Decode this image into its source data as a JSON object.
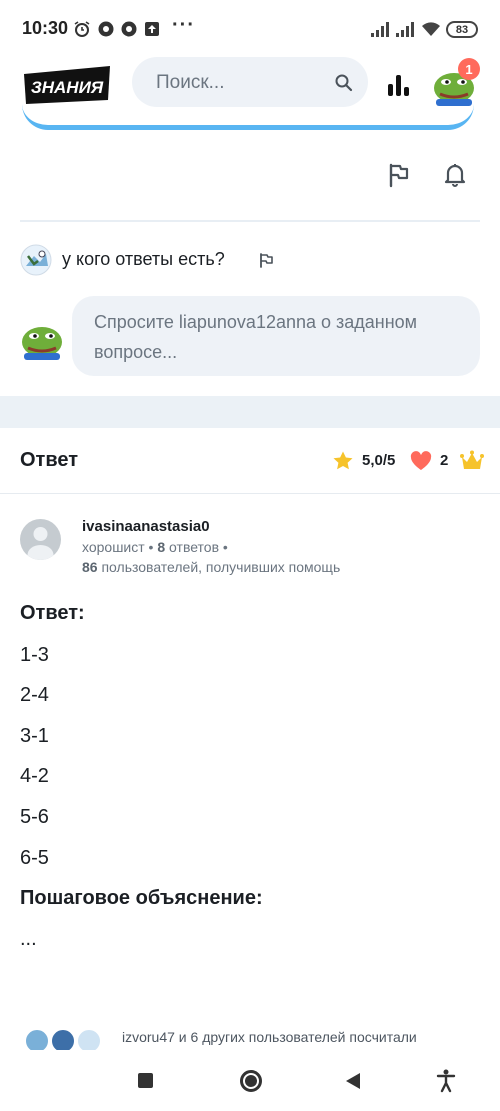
{
  "status_bar": {
    "time": "10:30",
    "dots": "···",
    "battery": "83",
    "icons": [
      "alarm-icon",
      "chrome-icon",
      "chrome-icon",
      "upload-icon",
      "signal-icon",
      "signal-icon",
      "wifi-icon",
      "battery-icon"
    ]
  },
  "header": {
    "logo_text": "ЗНАНИЯ",
    "search_placeholder": "Поиск...",
    "notification_count": "1"
  },
  "comments": {
    "items": [
      {
        "text": "у кого ответы есть?"
      }
    ],
    "input_placeholder": "Спросите liapunova12anna о заданном вопросе..."
  },
  "answer": {
    "title": "Ответ",
    "rating": "5,0/5",
    "thanks_count": "2",
    "author": {
      "username": "ivasinaanastasia0",
      "rank": "хорошист",
      "answers_count": "8",
      "answers_label": "ответов",
      "helped_count": "86",
      "helped_label": "пользователей, получивших помощь"
    },
    "heading": "Ответ:",
    "lines": [
      "1-3",
      "2-4",
      "3-1",
      "4-2",
      "5-6",
      "6-5"
    ],
    "explanation_heading": "Пошаговое объяснение:",
    "explanation": "..."
  },
  "footer": {
    "text": "izvoru47 и 6 других пользователей посчитали"
  },
  "colors": {
    "accent_blue": "#58b5f2",
    "badge": "#ff6a5c",
    "star": "#f6c32b",
    "heart": "#ff6a5c",
    "crown": "#f6c32b",
    "input_bg": "#eef2f7"
  }
}
